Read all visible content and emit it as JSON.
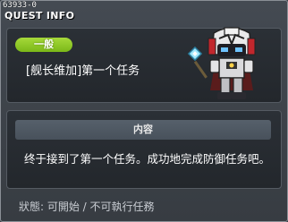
{
  "window": {
    "quest_id": "63933-0",
    "title": "QUEST INFO"
  },
  "quest": {
    "category_badge": "一般",
    "name": "[舰长维加]第一个任务",
    "npc_icon": "robot-captain-npc-icon"
  },
  "content": {
    "header": "内容",
    "description": "终于接到了第一个任务。成功地完成防御任务吧。"
  },
  "status": {
    "text": "狀態: 可開始 / 不可執行任務"
  },
  "colors": {
    "badge": "#8cc826",
    "panel_bg": "#262a2f",
    "window_bg": "#3f444b"
  }
}
